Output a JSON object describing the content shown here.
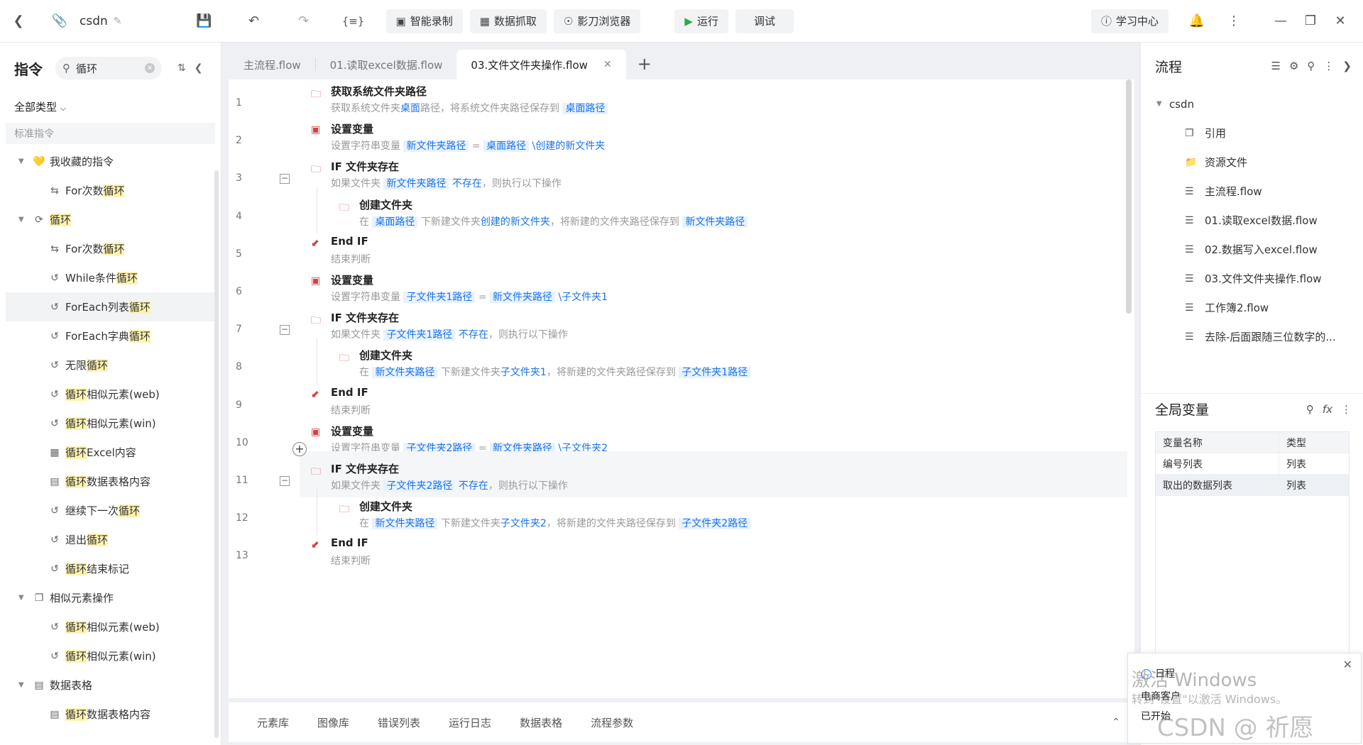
{
  "topbar": {
    "doc_name": "csdn",
    "record": "智能录制",
    "capture": "数据抓取",
    "browser": "影刀浏览器",
    "run": "运行",
    "debug": "调试",
    "learn": "学习中心"
  },
  "left": {
    "title": "指令",
    "search_value": "循环",
    "type_select": "全部类型",
    "category": "标准指令",
    "tree": [
      {
        "level": 0,
        "icon": "heart-icon",
        "parts": [
          [
            "我收藏的指令",
            false
          ]
        ]
      },
      {
        "level": 1,
        "icon": "repeat-icon",
        "parts": [
          [
            "For次数",
            false
          ],
          [
            "循环",
            true
          ]
        ]
      },
      {
        "level": 0,
        "icon": "loop-icon",
        "parts": [
          [
            "循环",
            true
          ]
        ]
      },
      {
        "level": 1,
        "icon": "repeat-icon",
        "parts": [
          [
            "For次数",
            false
          ],
          [
            "循环",
            true
          ]
        ]
      },
      {
        "level": 1,
        "icon": "loop-box-icon",
        "parts": [
          [
            "While条件",
            false
          ],
          [
            "循环",
            true
          ]
        ]
      },
      {
        "level": 1,
        "icon": "loop-box-icon",
        "parts": [
          [
            "ForEach列表",
            false
          ],
          [
            "循环",
            true
          ]
        ],
        "selected": true
      },
      {
        "level": 1,
        "icon": "loop-box-icon",
        "parts": [
          [
            "ForEach字典",
            false
          ],
          [
            "循环",
            true
          ]
        ]
      },
      {
        "level": 1,
        "icon": "loop-box-icon",
        "parts": [
          [
            "无限",
            false
          ],
          [
            "循环",
            true
          ]
        ]
      },
      {
        "level": 1,
        "icon": "loop-box-icon",
        "parts": [
          [
            "循环",
            true
          ],
          [
            "相似元素(web)",
            false
          ]
        ]
      },
      {
        "level": 1,
        "icon": "loop-box-icon",
        "parts": [
          [
            "循环",
            true
          ],
          [
            "相似元素(win)",
            false
          ]
        ]
      },
      {
        "level": 1,
        "icon": "excel-icon",
        "parts": [
          [
            "循环",
            true
          ],
          [
            "Excel内容",
            false
          ]
        ]
      },
      {
        "level": 1,
        "icon": "table-icon",
        "parts": [
          [
            "循环",
            true
          ],
          [
            "数据表格内容",
            false
          ]
        ]
      },
      {
        "level": 1,
        "icon": "loop-box-icon",
        "parts": [
          [
            "继续下一次",
            false
          ],
          [
            "循环",
            true
          ]
        ]
      },
      {
        "level": 1,
        "icon": "loop-box-icon",
        "parts": [
          [
            "退出",
            false
          ],
          [
            "循环",
            true
          ]
        ]
      },
      {
        "level": 1,
        "icon": "loop-box-icon",
        "parts": [
          [
            "循环",
            true
          ],
          [
            "结束标记",
            false
          ]
        ]
      },
      {
        "level": 0,
        "icon": "similar-icon",
        "parts": [
          [
            "相似元素操作",
            false
          ]
        ]
      },
      {
        "level": 1,
        "icon": "loop-box-icon",
        "parts": [
          [
            "循环",
            true
          ],
          [
            "相似元素(web)",
            false
          ]
        ]
      },
      {
        "level": 1,
        "icon": "loop-box-icon",
        "parts": [
          [
            "循环",
            true
          ],
          [
            "相似元素(win)",
            false
          ]
        ]
      },
      {
        "level": 0,
        "icon": "table-icon",
        "parts": [
          [
            "数据表格",
            false
          ]
        ]
      },
      {
        "level": 1,
        "icon": "table-icon",
        "parts": [
          [
            "循环",
            true
          ],
          [
            "数据表格内容",
            false
          ]
        ]
      }
    ]
  },
  "tabs": [
    {
      "label": "主流程.flow",
      "active": false
    },
    {
      "label": "01.读取excel数据.flow",
      "active": false
    },
    {
      "label": "03.文件文件夹操作.flow",
      "active": true
    }
  ],
  "editor": {
    "lines": [
      {
        "no": "1",
        "indent": 0,
        "icon": "folder-path-icon",
        "title": "获取系统文件夹路径",
        "desc": [
          [
            "t",
            "获取系统文件夹"
          ],
          [
            "s",
            "桌面"
          ],
          [
            "t",
            "路径，将系统文件夹路径保存到 "
          ],
          [
            "v",
            "桌面路径"
          ]
        ]
      },
      {
        "no": "2",
        "indent": 0,
        "icon": "variable-icon",
        "title": "设置变量",
        "desc": [
          [
            "t",
            "设置字符串变量 "
          ],
          [
            "v",
            "新文件夹路径"
          ],
          [
            "t",
            " = "
          ],
          [
            "v",
            "桌面路径"
          ],
          [
            "s",
            " \\创建的新文件夹"
          ]
        ]
      },
      {
        "no": "3",
        "indent": 0,
        "icon": "folder-check-icon",
        "title": "IF 文件夹存在",
        "collapse": true,
        "desc": [
          [
            "t",
            "如果文件夹 "
          ],
          [
            "v",
            "新文件夹路径"
          ],
          [
            "s",
            " 不存在"
          ],
          [
            "t",
            "，则执行以下操作"
          ]
        ]
      },
      {
        "no": "4",
        "indent": 1,
        "icon": "folder-new-icon",
        "title": "创建文件夹",
        "desc": [
          [
            "t",
            "在 "
          ],
          [
            "v",
            "桌面路径"
          ],
          [
            "t",
            " 下新建文件夹"
          ],
          [
            "s",
            "创建的新文件夹"
          ],
          [
            "t",
            "，将新建的文件夹路径保存到 "
          ],
          [
            "v",
            "新文件夹路径"
          ]
        ]
      },
      {
        "no": "5",
        "indent": 0,
        "icon": "end-if-icon",
        "title": "End IF",
        "desc": [
          [
            "t",
            "结束判断"
          ]
        ]
      },
      {
        "no": "6",
        "indent": 0,
        "icon": "variable-icon",
        "title": "设置变量",
        "desc": [
          [
            "t",
            "设置字符串变量 "
          ],
          [
            "v",
            "子文件夹1路径"
          ],
          [
            "t",
            " = "
          ],
          [
            "v",
            "新文件夹路径"
          ],
          [
            "s",
            " \\子文件夹1"
          ]
        ]
      },
      {
        "no": "7",
        "indent": 0,
        "icon": "folder-check-icon",
        "title": "IF 文件夹存在",
        "collapse": true,
        "desc": [
          [
            "t",
            "如果文件夹 "
          ],
          [
            "v",
            "子文件夹1路径"
          ],
          [
            "s",
            " 不存在"
          ],
          [
            "t",
            "，则执行以下操作"
          ]
        ]
      },
      {
        "no": "8",
        "indent": 1,
        "icon": "folder-new-icon",
        "title": "创建文件夹",
        "desc": [
          [
            "t",
            "在 "
          ],
          [
            "v",
            "新文件夹路径"
          ],
          [
            "t",
            " 下新建文件夹"
          ],
          [
            "s",
            "子文件夹1"
          ],
          [
            "t",
            "，将新建的文件夹路径保存到 "
          ],
          [
            "v",
            "子文件夹1路径"
          ]
        ]
      },
      {
        "no": "9",
        "indent": 0,
        "icon": "end-if-icon",
        "title": "End IF",
        "desc": [
          [
            "t",
            "结束判断"
          ]
        ]
      },
      {
        "no": "10",
        "indent": 0,
        "icon": "variable-icon",
        "title": "设置变量",
        "desc": [
          [
            "t",
            "设置字符串变量 "
          ],
          [
            "v",
            "子文件夹2路径"
          ],
          [
            "t",
            " = "
          ],
          [
            "v",
            "新文件夹路径"
          ],
          [
            "s",
            " \\子文件夹2"
          ]
        ]
      },
      {
        "no": "11",
        "indent": 0,
        "icon": "folder-check-icon",
        "title": "IF 文件夹存在",
        "collapse": true,
        "hover": true,
        "desc": [
          [
            "t",
            "如果文件夹 "
          ],
          [
            "v",
            "子文件夹2路径"
          ],
          [
            "s",
            " 不存在"
          ],
          [
            "t",
            "，则执行以下操作"
          ]
        ]
      },
      {
        "no": "12",
        "indent": 1,
        "icon": "folder-new-icon",
        "title": "创建文件夹",
        "desc": [
          [
            "t",
            "在 "
          ],
          [
            "v",
            "新文件夹路径"
          ],
          [
            "t",
            " 下新建文件夹"
          ],
          [
            "s",
            "子文件夹2"
          ],
          [
            "t",
            "，将新建的文件夹路径保存到 "
          ],
          [
            "v",
            "子文件夹2路径"
          ]
        ]
      },
      {
        "no": "13",
        "indent": 0,
        "icon": "end-if-icon",
        "title": "End IF",
        "desc": [
          [
            "t",
            "结束判断"
          ]
        ]
      }
    ]
  },
  "bottom_tabs": [
    "元素库",
    "图像库",
    "错误列表",
    "运行日志",
    "数据表格",
    "流程参数"
  ],
  "right": {
    "title": "流程",
    "root": "csdn",
    "items": [
      {
        "icon": "reference-icon",
        "label": "引用"
      },
      {
        "icon": "resource-icon",
        "label": "资源文件"
      },
      {
        "icon": "layers-icon",
        "label": "主流程.flow"
      },
      {
        "icon": "layers-icon",
        "label": "01.读取excel数据.flow"
      },
      {
        "icon": "layers-icon",
        "label": "02.数据写入excel.flow"
      },
      {
        "icon": "layers-icon",
        "label": "03.文件文件夹操作.flow"
      },
      {
        "icon": "layers-icon",
        "label": "工作簿2.flow"
      },
      {
        "icon": "layers-icon",
        "label": "去除-后面跟随三位数字的..."
      }
    ],
    "gv_title": "全局变量",
    "gv_columns": [
      "变量名称",
      "类型"
    ],
    "gv_rows": [
      [
        "编号列表",
        "列表"
      ],
      [
        "取出的数据列表",
        "列表"
      ]
    ]
  },
  "notification": {
    "line1": "日程",
    "line2": "电商客户",
    "line3": "已开始",
    "watermark1": "激活 Windows",
    "watermark2": "转到\"设置\"以激活 Windows。",
    "watermark3": "CSDN @  祈愿"
  }
}
